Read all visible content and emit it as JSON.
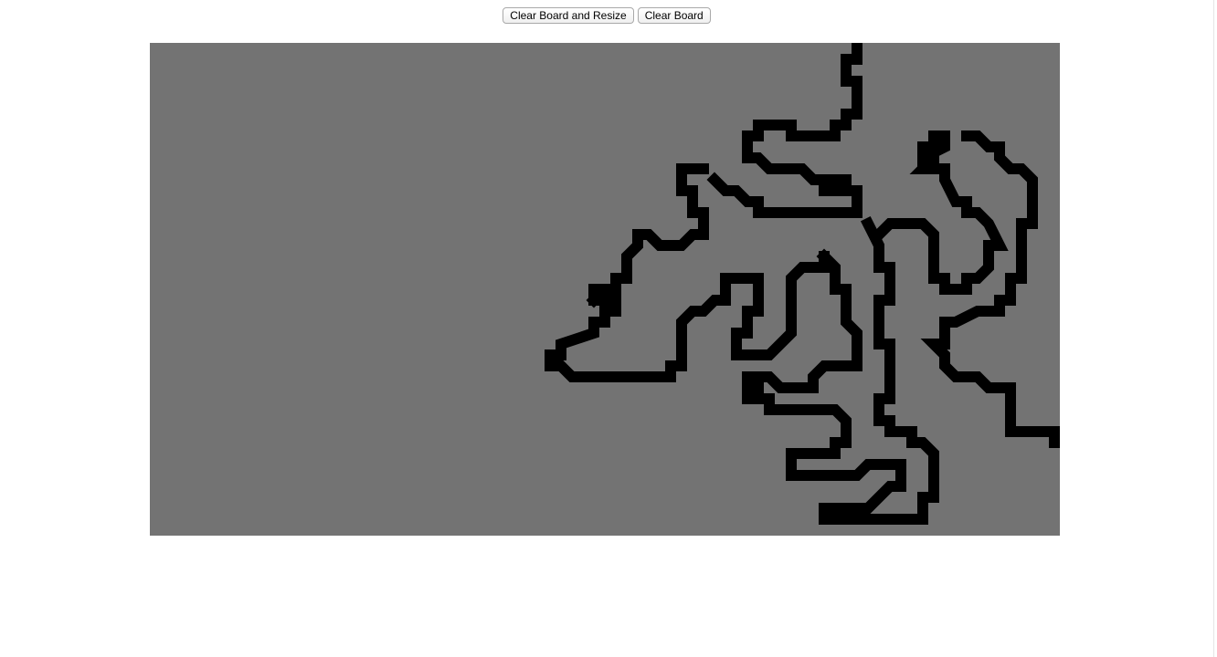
{
  "toolbar": {
    "clear_resize_label": "Clear Board and Resize",
    "clear_label": "Clear Board"
  },
  "board": {
    "background_color": "#737373",
    "cell_color": "#000000",
    "columns": 83,
    "rows": 45,
    "rows_data": [
      "..............................................................##.................",
      "..............................................................#..................",
      "..............................................................#..................",
      ".............................................................##..................",
      "..............................................................#..................",
      "..............................................................#..................",
      "..............................................................#..................",
      "............................................................##...................",
      "...............................................................................",
      "................................................................................."
    ]
  }
}
